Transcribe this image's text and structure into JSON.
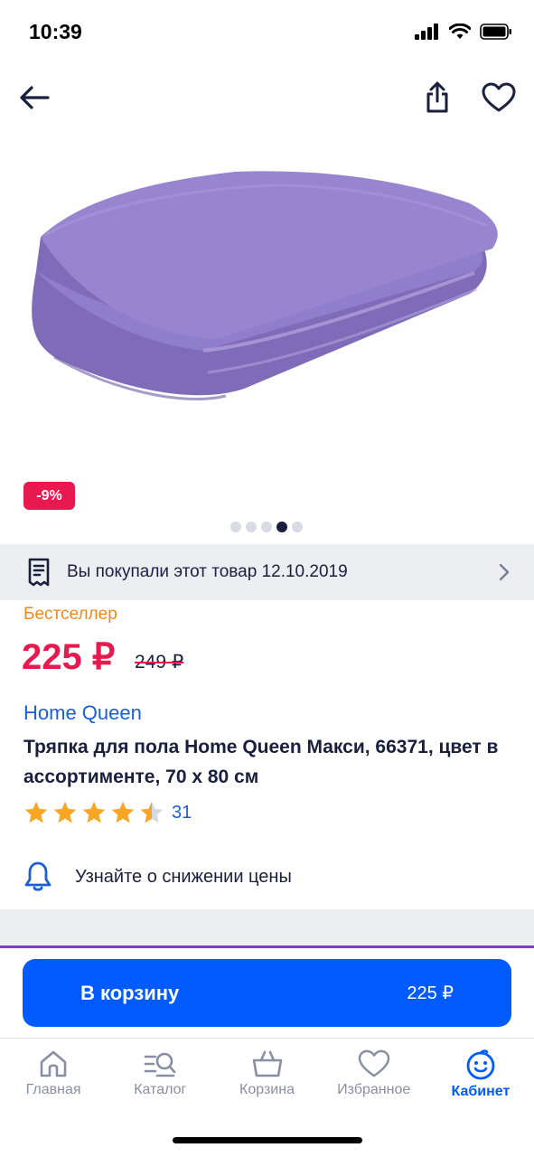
{
  "status": {
    "time": "10:39"
  },
  "header": {
    "back_icon": "arrow-left-icon",
    "share_icon": "share-icon",
    "favorite_icon": "heart-icon"
  },
  "product": {
    "discount": "-9%",
    "gallery": {
      "count": 5,
      "active_index": 3
    },
    "purchased_notice": "Вы покупали этот товар 12.10.2019",
    "badge": "Бестселлер",
    "price": "225 ₽",
    "old_price": "249 ₽",
    "brand": "Home Queen",
    "title": "Тряпка для пола Home Queen Макси, 66371, цвет в ассортименте, 70 х 80 см",
    "rating": 4.5,
    "reviews_count": "31",
    "price_alert": "Узнайте о снижении цены"
  },
  "cart_button": {
    "label": "В корзину",
    "price": "225 ₽"
  },
  "tabbar": {
    "items": [
      {
        "label": "Главная",
        "icon": "home-icon"
      },
      {
        "label": "Каталог",
        "icon": "catalog-search-icon"
      },
      {
        "label": "Корзина",
        "icon": "basket-icon"
      },
      {
        "label": "Избранное",
        "icon": "heart-icon"
      },
      {
        "label": "Кабинет",
        "icon": "profile-face-icon",
        "active": true
      }
    ]
  },
  "colors": {
    "accent": "#005bff",
    "price": "#e8194f",
    "bestseller": "#f08a1c",
    "brand": "#1b5ed6",
    "towel": "#8e7bc4"
  }
}
